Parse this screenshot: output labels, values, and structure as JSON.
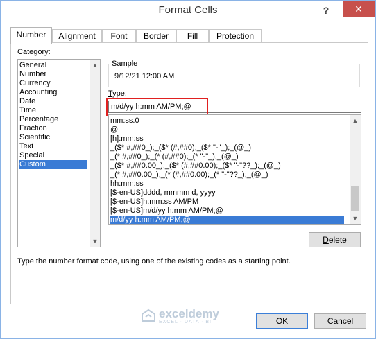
{
  "window": {
    "title": "Format Cells",
    "help_label": "?",
    "close_label": "✕"
  },
  "tabs": [
    {
      "label": "Number",
      "active": true
    },
    {
      "label": "Alignment",
      "active": false
    },
    {
      "label": "Font",
      "active": false
    },
    {
      "label": "Border",
      "active": false
    },
    {
      "label": "Fill",
      "active": false
    },
    {
      "label": "Protection",
      "active": false
    }
  ],
  "category": {
    "label_prefix": "C",
    "label_rest": "ategory:",
    "items": [
      "General",
      "Number",
      "Currency",
      "Accounting",
      "Date",
      "Time",
      "Percentage",
      "Fraction",
      "Scientific",
      "Text",
      "Special",
      "Custom"
    ],
    "selected": "Custom"
  },
  "sample": {
    "label": "Sample",
    "value": "9/12/21 12:00 AM"
  },
  "type": {
    "label_prefix": "T",
    "label_rest": "ype:",
    "value": "m/d/yy h:mm AM/PM;@",
    "formats": [
      "mm:ss.0",
      "@",
      "[h]:mm:ss",
      "_($* #,##0_);_($* (#,##0);_($* \"-\"_);_(@_)",
      "_(* #,##0_);_(* (#,##0);_(* \"-\"_);_(@_)",
      "_($* #,##0.00_);_($* (#,##0.00);_($* \"-\"??_);_(@_)",
      "_(* #,##0.00_);_(* (#,##0.00);_(* \"-\"??_);_(@_)",
      "hh:mm:ss",
      "[$-en-US]dddd, mmmm d, yyyy",
      "[$-en-US]h:mm:ss AM/PM",
      "[$-en-US]m/d/yy h:mm AM/PM;@",
      "m/d/yy h:mm AM/PM;@"
    ],
    "selected": "m/d/yy h:mm AM/PM;@"
  },
  "buttons": {
    "delete_prefix": "D",
    "delete_rest": "elete",
    "ok": "OK",
    "cancel": "Cancel"
  },
  "description": "Type the number format code, using one of the existing codes as a starting point.",
  "watermark": {
    "name": "exceldemy",
    "tagline": "EXCEL · DATA · BI"
  },
  "colors": {
    "selection": "#3a7bd5",
    "highlight": "#e02020",
    "close": "#c7504c"
  }
}
